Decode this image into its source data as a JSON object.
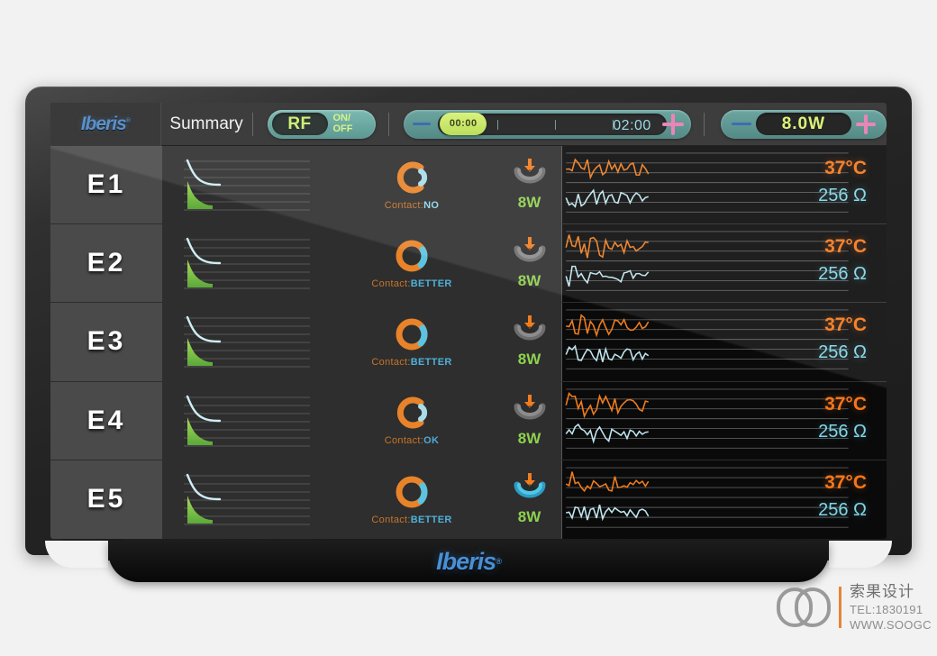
{
  "device": {
    "brand": "Iberis",
    "bottom_logo": "Iberis"
  },
  "header": {
    "title": "Summary",
    "rf_button": {
      "label": "RF",
      "state_line1": "ON/",
      "state_line2": "OFF"
    },
    "timer": {
      "current": "00:00",
      "target": "02:00",
      "minus_icon": "minus-icon",
      "plus_icon": "plus-icon"
    },
    "power": {
      "value": "8.0W",
      "minus_icon": "minus-icon",
      "plus_icon": "plus-icon"
    }
  },
  "electrodes": [
    {
      "id": "E1",
      "contact_word": "Contact:",
      "contact_state": "NO",
      "contact_icon": "contact-ring-broken-icon",
      "gauge_percent": "0%",
      "gauge_active": false,
      "gauge_icon": "power-down-arrow-icon",
      "power": "8W",
      "temperature": "37°C",
      "impedance": "256 Ω"
    },
    {
      "id": "E2",
      "contact_word": "Contact:",
      "contact_state": "BETTER",
      "contact_icon": "contact-ring-full-icon",
      "gauge_percent": "0%",
      "gauge_active": false,
      "gauge_icon": "power-down-arrow-icon",
      "power": "8W",
      "temperature": "37°C",
      "impedance": "256 Ω"
    },
    {
      "id": "E3",
      "contact_word": "Contact:",
      "contact_state": "BETTER",
      "contact_icon": "contact-ring-full-icon",
      "gauge_percent": "0%",
      "gauge_active": false,
      "gauge_icon": "power-down-arrow-icon",
      "power": "8W",
      "temperature": "37°C",
      "impedance": "256 Ω"
    },
    {
      "id": "E4",
      "contact_word": "Contact:",
      "contact_state": "OK",
      "contact_icon": "contact-ring-broken-icon",
      "gauge_percent": "0%",
      "gauge_active": false,
      "gauge_icon": "power-down-arrow-icon",
      "power": "8W",
      "temperature": "37°C",
      "impedance": "256 Ω"
    },
    {
      "id": "E5",
      "contact_word": "Contact:",
      "contact_state": "BETTER",
      "contact_icon": "contact-ring-full-icon",
      "gauge_percent": "0%",
      "gauge_active": true,
      "gauge_icon": "power-down-arrow-icon",
      "power": "8W",
      "temperature": "37°C",
      "impedance": "256 Ω"
    }
  ],
  "colors": {
    "accent_teal": "#5f9d98",
    "rf_green": "#c8f06a",
    "temp_orange": "#f5761a",
    "impedance_cyan": "#7fd6e8",
    "contact_orange": "#e8832a",
    "watt_green": "#8ed14f",
    "brand_blue": "#4b86c4"
  },
  "watermark": {
    "company": "索果设计",
    "tel": "TEL:1830191",
    "url": "WWW.SOOGC"
  }
}
